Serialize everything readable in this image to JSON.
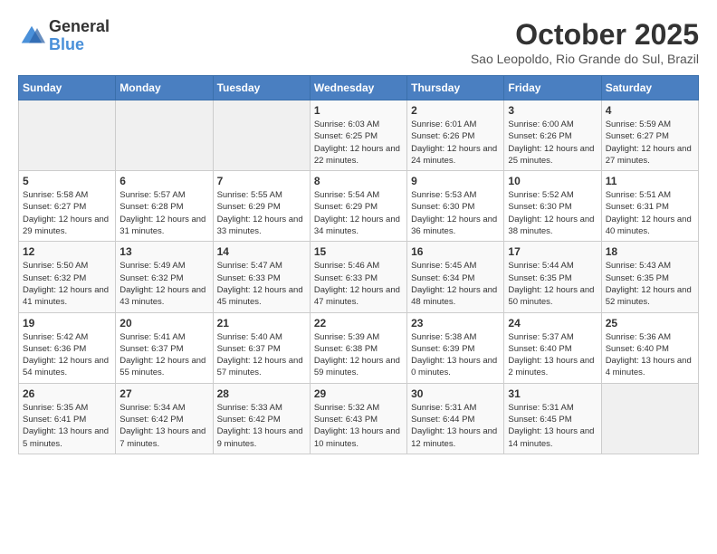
{
  "header": {
    "logo": {
      "general": "General",
      "blue": "Blue"
    },
    "title": "October 2025",
    "location": "Sao Leopoldo, Rio Grande do Sul, Brazil"
  },
  "weekdays": [
    "Sunday",
    "Monday",
    "Tuesday",
    "Wednesday",
    "Thursday",
    "Friday",
    "Saturday"
  ],
  "weeks": [
    [
      {
        "day": "",
        "detail": ""
      },
      {
        "day": "",
        "detail": ""
      },
      {
        "day": "",
        "detail": ""
      },
      {
        "day": "1",
        "detail": "Sunrise: 6:03 AM\nSunset: 6:25 PM\nDaylight: 12 hours\nand 22 minutes."
      },
      {
        "day": "2",
        "detail": "Sunrise: 6:01 AM\nSunset: 6:26 PM\nDaylight: 12 hours\nand 24 minutes."
      },
      {
        "day": "3",
        "detail": "Sunrise: 6:00 AM\nSunset: 6:26 PM\nDaylight: 12 hours\nand 25 minutes."
      },
      {
        "day": "4",
        "detail": "Sunrise: 5:59 AM\nSunset: 6:27 PM\nDaylight: 12 hours\nand 27 minutes."
      }
    ],
    [
      {
        "day": "5",
        "detail": "Sunrise: 5:58 AM\nSunset: 6:27 PM\nDaylight: 12 hours\nand 29 minutes."
      },
      {
        "day": "6",
        "detail": "Sunrise: 5:57 AM\nSunset: 6:28 PM\nDaylight: 12 hours\nand 31 minutes."
      },
      {
        "day": "7",
        "detail": "Sunrise: 5:55 AM\nSunset: 6:29 PM\nDaylight: 12 hours\nand 33 minutes."
      },
      {
        "day": "8",
        "detail": "Sunrise: 5:54 AM\nSunset: 6:29 PM\nDaylight: 12 hours\nand 34 minutes."
      },
      {
        "day": "9",
        "detail": "Sunrise: 5:53 AM\nSunset: 6:30 PM\nDaylight: 12 hours\nand 36 minutes."
      },
      {
        "day": "10",
        "detail": "Sunrise: 5:52 AM\nSunset: 6:30 PM\nDaylight: 12 hours\nand 38 minutes."
      },
      {
        "day": "11",
        "detail": "Sunrise: 5:51 AM\nSunset: 6:31 PM\nDaylight: 12 hours\nand 40 minutes."
      }
    ],
    [
      {
        "day": "12",
        "detail": "Sunrise: 5:50 AM\nSunset: 6:32 PM\nDaylight: 12 hours\nand 41 minutes."
      },
      {
        "day": "13",
        "detail": "Sunrise: 5:49 AM\nSunset: 6:32 PM\nDaylight: 12 hours\nand 43 minutes."
      },
      {
        "day": "14",
        "detail": "Sunrise: 5:47 AM\nSunset: 6:33 PM\nDaylight: 12 hours\nand 45 minutes."
      },
      {
        "day": "15",
        "detail": "Sunrise: 5:46 AM\nSunset: 6:33 PM\nDaylight: 12 hours\nand 47 minutes."
      },
      {
        "day": "16",
        "detail": "Sunrise: 5:45 AM\nSunset: 6:34 PM\nDaylight: 12 hours\nand 48 minutes."
      },
      {
        "day": "17",
        "detail": "Sunrise: 5:44 AM\nSunset: 6:35 PM\nDaylight: 12 hours\nand 50 minutes."
      },
      {
        "day": "18",
        "detail": "Sunrise: 5:43 AM\nSunset: 6:35 PM\nDaylight: 12 hours\nand 52 minutes."
      }
    ],
    [
      {
        "day": "19",
        "detail": "Sunrise: 5:42 AM\nSunset: 6:36 PM\nDaylight: 12 hours\nand 54 minutes."
      },
      {
        "day": "20",
        "detail": "Sunrise: 5:41 AM\nSunset: 6:37 PM\nDaylight: 12 hours\nand 55 minutes."
      },
      {
        "day": "21",
        "detail": "Sunrise: 5:40 AM\nSunset: 6:37 PM\nDaylight: 12 hours\nand 57 minutes."
      },
      {
        "day": "22",
        "detail": "Sunrise: 5:39 AM\nSunset: 6:38 PM\nDaylight: 12 hours\nand 59 minutes."
      },
      {
        "day": "23",
        "detail": "Sunrise: 5:38 AM\nSunset: 6:39 PM\nDaylight: 13 hours\nand 0 minutes."
      },
      {
        "day": "24",
        "detail": "Sunrise: 5:37 AM\nSunset: 6:40 PM\nDaylight: 13 hours\nand 2 minutes."
      },
      {
        "day": "25",
        "detail": "Sunrise: 5:36 AM\nSunset: 6:40 PM\nDaylight: 13 hours\nand 4 minutes."
      }
    ],
    [
      {
        "day": "26",
        "detail": "Sunrise: 5:35 AM\nSunset: 6:41 PM\nDaylight: 13 hours\nand 5 minutes."
      },
      {
        "day": "27",
        "detail": "Sunrise: 5:34 AM\nSunset: 6:42 PM\nDaylight: 13 hours\nand 7 minutes."
      },
      {
        "day": "28",
        "detail": "Sunrise: 5:33 AM\nSunset: 6:42 PM\nDaylight: 13 hours\nand 9 minutes."
      },
      {
        "day": "29",
        "detail": "Sunrise: 5:32 AM\nSunset: 6:43 PM\nDaylight: 13 hours\nand 10 minutes."
      },
      {
        "day": "30",
        "detail": "Sunrise: 5:31 AM\nSunset: 6:44 PM\nDaylight: 13 hours\nand 12 minutes."
      },
      {
        "day": "31",
        "detail": "Sunrise: 5:31 AM\nSunset: 6:45 PM\nDaylight: 13 hours\nand 14 minutes."
      },
      {
        "day": "",
        "detail": ""
      }
    ]
  ]
}
